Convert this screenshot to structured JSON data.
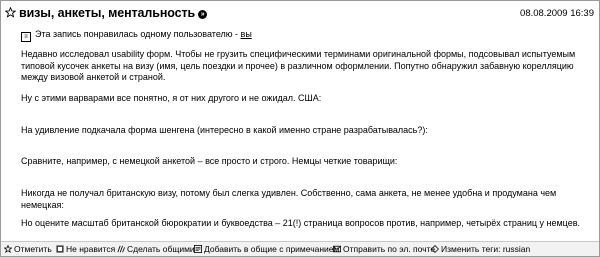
{
  "post": {
    "title": "визы, анкеты, ментальность",
    "date": "08.08.2009 16:39",
    "liked_text": "Эта запись понравилась одному пользователю - ",
    "liked_link": "вы",
    "paragraphs": [
      "Недавно исследовал usability форм. Чтобы не грузить специфическими терминами оригинальной формы, подсовывал испытуемым типовой кусочек анкеты на визу (имя, цель поездки и прочее) в различном оформлении. Попутно обнаружил забавную корелляцию между визовой анкетой и страной.",
      "Ну с этими варварами все понятно, я от них другого и не ожидал. США:",
      "На удивление подкачала форма шенгена (интересно в какой именно стране разрабатывалась?):",
      "Сравните, например, с немецкой анкетой – все просто и строго. Немцы четкие товарищи:",
      "Никогда не получал британскую визу, потому был слегка удивлен. Собственно, сама анкета, не менее удобна и продумана чем немецкая:",
      "Но оцените масштаб британской бюрократии и буквоедства – 21(!) страница вопросов против, например, четырёх страниц у немцев."
    ]
  },
  "footer": {
    "actions": [
      {
        "label": "Отметить",
        "icon": "star-icon"
      },
      {
        "label": "Не нравится",
        "icon": "dislike-icon"
      },
      {
        "label": "Сделать общими",
        "icon": "share-icon"
      },
      {
        "label": "Добавить в общие с примечанием",
        "icon": "note-icon"
      },
      {
        "label": "Отправить по эл. почте",
        "icon": "mail-icon"
      },
      {
        "label": "Изменить теги:",
        "icon": "tag-icon"
      }
    ],
    "tag": "russian"
  }
}
